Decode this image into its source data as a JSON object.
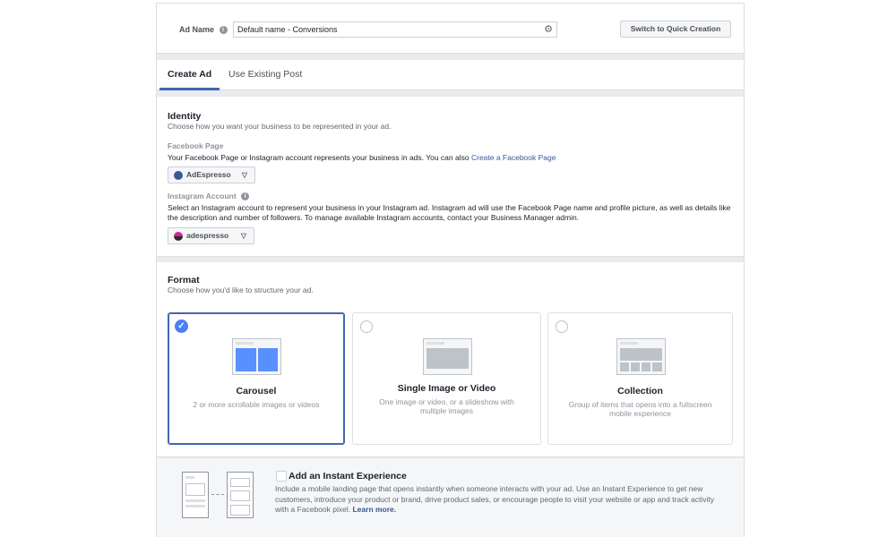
{
  "ad_name": {
    "label": "Ad Name",
    "value": "Default name - Conversions",
    "switch_button": "Switch to Quick Creation"
  },
  "tabs": [
    {
      "label": "Create Ad",
      "active": true
    },
    {
      "label": "Use Existing Post",
      "active": false
    }
  ],
  "identity": {
    "title": "Identity",
    "subtitle": "Choose how you want your business to be represented in your ad.",
    "facebook_page": {
      "label": "Facebook Page",
      "description": "Your Facebook Page or Instagram account represents your business in ads. You can also",
      "link": "Create a Facebook Page",
      "selected": "AdEspresso"
    },
    "instagram_account": {
      "label": "Instagram Account",
      "description": "Select an Instagram account to represent your business in your Instagram ad. Instagram ad will use the Facebook Page name and profile picture, as well as details like the description and number of followers. To manage available Instagram accounts, contact your Business Manager admin.",
      "selected": "adespresso"
    }
  },
  "format": {
    "title": "Format",
    "subtitle": "Choose how you'd like to structure your ad.",
    "options": [
      {
        "title": "Carousel",
        "description": "2 or more scrollable images or videos",
        "selected": true
      },
      {
        "title": "Single Image or Video",
        "description": "One image or video, or a slideshow with multiple images",
        "selected": false
      },
      {
        "title": "Collection",
        "description": "Group of items that opens into a fullscreen mobile experience",
        "selected": false
      }
    ]
  },
  "instant_experience": {
    "title": "Add an Instant Experience",
    "description": "Include a mobile landing page that opens instantly when someone interacts with your ad. Use an Instant Experience to get new customers, introduce your product or brand, drive product sales, or encourage people to visit your website or app and track activity with a Facebook pixel.",
    "link": "Learn more."
  },
  "colors": {
    "accent": "#4267b2",
    "check": "#4a7ff5",
    "carousel_tile": "#5890ff",
    "link": "#365899"
  },
  "icons": {
    "settings": "gear-icon",
    "info": "info-icon",
    "dropdown": "caret-down-icon",
    "selected": "checkmark-icon"
  }
}
